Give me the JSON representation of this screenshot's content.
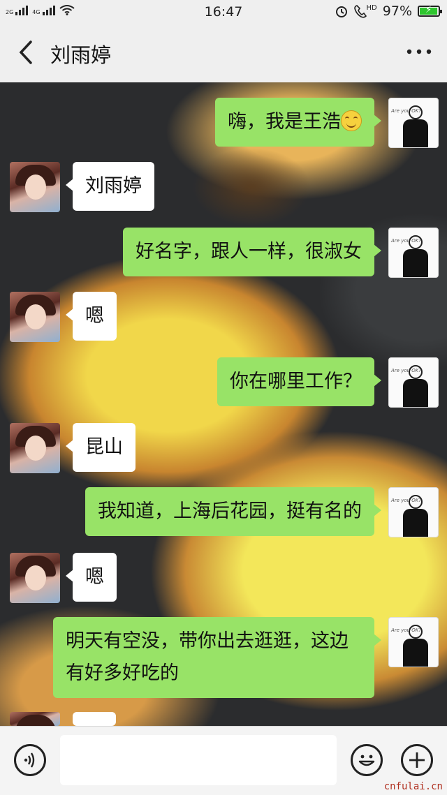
{
  "status_bar": {
    "signal1": "2G",
    "signal2": "4G",
    "time": "16:47",
    "hd": "HD",
    "battery": "97%",
    "battery_level": 0.97
  },
  "header": {
    "contact_name": "刘雨婷"
  },
  "messages": [
    {
      "from": "me",
      "text": "嗨，我是王浩",
      "emoji": "smile"
    },
    {
      "from": "her",
      "text": "刘雨婷"
    },
    {
      "from": "me",
      "text": "好名字，跟人一样，很淑女"
    },
    {
      "from": "her",
      "text": "嗯"
    },
    {
      "from": "me",
      "text": "你在哪里工作？"
    },
    {
      "from": "her",
      "text": "昆山"
    },
    {
      "from": "me",
      "text": "我知道，上海后花园，挺有名的"
    },
    {
      "from": "her",
      "text": "嗯"
    },
    {
      "from": "me",
      "text": "明天有空没，带你出去逛逛，这边有好多好吃的"
    }
  ],
  "input": {
    "value": "",
    "placeholder": ""
  },
  "watermark": "cnfulai.cn",
  "colors": {
    "my_bubble": "#98e367",
    "their_bubble": "#ffffff",
    "bar": "#efefef"
  }
}
